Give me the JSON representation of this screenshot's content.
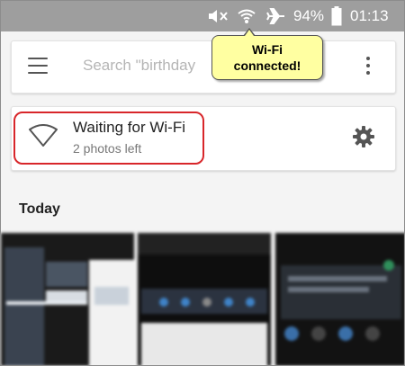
{
  "status_bar": {
    "battery_percent": "94%",
    "time": "01:13",
    "icons": [
      "mute-icon",
      "wifi-icon",
      "airplane-icon",
      "battery-icon"
    ]
  },
  "search": {
    "placeholder": "Search \"birthday"
  },
  "callout": {
    "line1": "Wi-Fi",
    "line2": "connected!"
  },
  "backup": {
    "title": "Waiting for Wi-Fi",
    "subtitle": "2 photos left"
  },
  "section": {
    "heading": "Today"
  },
  "colors": {
    "status_bar": "#9e9e9e",
    "highlight": "#d8262a",
    "callout_bg": "#ffffa1"
  }
}
